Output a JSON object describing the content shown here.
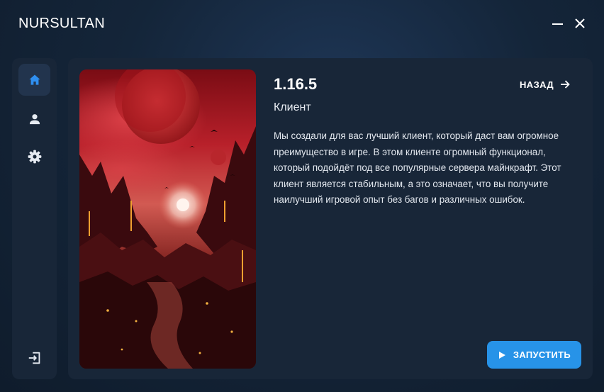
{
  "window": {
    "title": "NURSULTAN"
  },
  "sidebar": {
    "items": [
      {
        "icon": "home-icon",
        "active": true
      },
      {
        "icon": "user-icon",
        "active": false
      },
      {
        "icon": "gear-icon",
        "active": false
      }
    ],
    "footer_icon": "logout-icon"
  },
  "main": {
    "version": "1.16.5",
    "subtitle": "Клиент",
    "back_label": "НАЗАД",
    "description": "Мы создали для вас лучший клиент, который даст вам огромное преимущество в игре. В этом клиенте огромный функционал, который подойдёт под все популярные сервера майнкрафт. Этот клиент является стабильным, а это означает, что вы получите наилучший игровой опыт без багов и различных ошибок.",
    "launch_label": "ЗАПУСТИТЬ"
  },
  "colors": {
    "accent": "#2793e8",
    "panel": "#182638",
    "active_item": "#22344d",
    "icon_active": "#2f8ff0",
    "icon": "#e6ebf2"
  }
}
